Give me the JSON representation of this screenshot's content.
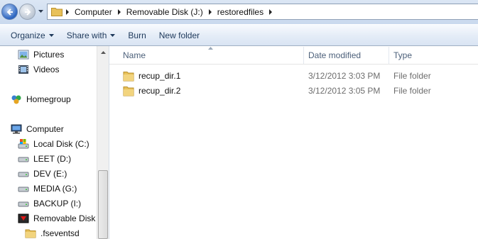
{
  "address_bar": {
    "breadcrumbs": [
      "Computer",
      "Removable Disk (J:)",
      "restoredfiles"
    ]
  },
  "toolbar": {
    "organize_label": "Organize",
    "share_with_label": "Share with",
    "burn_label": "Burn",
    "new_folder_label": "New folder"
  },
  "nav_pane": {
    "items": [
      {
        "label": "Pictures",
        "icon": "pictures-icon"
      },
      {
        "label": "Videos",
        "icon": "videos-icon"
      },
      {
        "label": "Homegroup",
        "icon": "homegroup-icon"
      },
      {
        "label": "Computer",
        "icon": "computer-icon"
      },
      {
        "label": "Local Disk (C:)",
        "icon": "system-drive-icon"
      },
      {
        "label": "LEET (D:)",
        "icon": "drive-icon"
      },
      {
        "label": "DEV (E:)",
        "icon": "drive-icon"
      },
      {
        "label": "MEDIA (G:)",
        "icon": "drive-icon"
      },
      {
        "label": "BACKUP (I:)",
        "icon": "drive-icon"
      },
      {
        "label": "Removable Disk (",
        "icon": "removable-disk-icon"
      },
      {
        "label": ".fseventsd",
        "icon": "folder-icon"
      }
    ]
  },
  "file_list": {
    "columns": {
      "name": "Name",
      "date_modified": "Date modified",
      "type": "Type"
    },
    "rows": [
      {
        "name": "recup_dir.1",
        "date": "3/12/2012 3:03 PM",
        "type": "File folder"
      },
      {
        "name": "recup_dir.2",
        "date": "3/12/2012 3:05 PM",
        "type": "File folder"
      }
    ]
  },
  "colors": {
    "folder_yellow": "#e8c15a",
    "toolbar_text": "#1e395b",
    "header_text": "#4c607a"
  }
}
